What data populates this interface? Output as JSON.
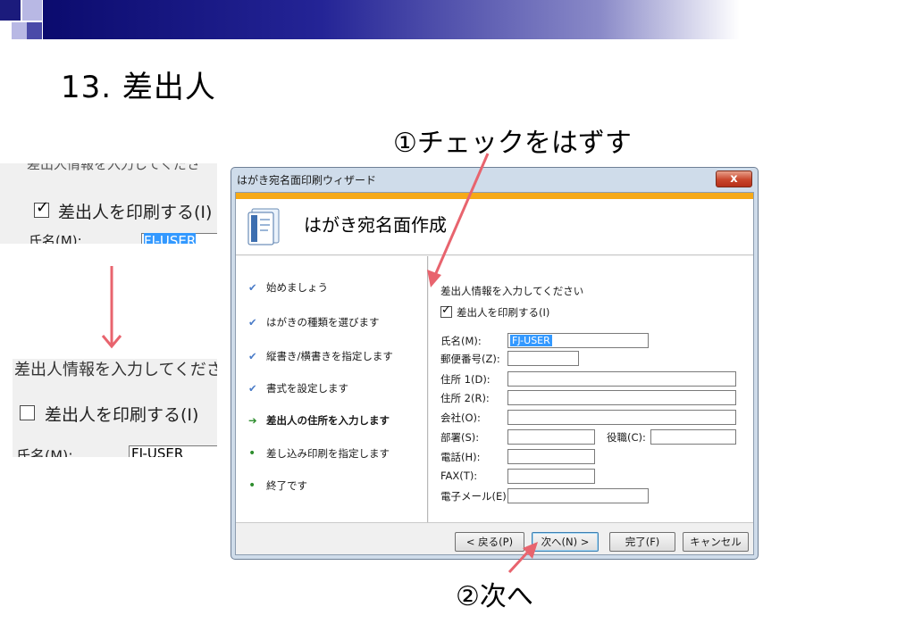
{
  "slide": {
    "title": "13. 差出人"
  },
  "annotations": {
    "step1": "①チェックをはずす",
    "step2": "②次へ"
  },
  "zoom_before": {
    "header_text": "差出人情報を入力してくださ",
    "checkbox_label": "差出人を印刷する(I)",
    "checkbox_checked": true,
    "name_label": "氏名(M):",
    "name_value": "FJ-USER"
  },
  "zoom_after": {
    "header_text": "差出人情報を入力してくださ",
    "checkbox_label": "差出人を印刷する(I)",
    "checkbox_checked": false,
    "name_label": "氏名(M):",
    "name_value": "FJ-USER"
  },
  "window": {
    "title": "はがき宛名面印刷ウィザード",
    "close_label": "x",
    "banner_title": "はがき宛名面作成",
    "steps": [
      {
        "label": "始めましょう",
        "state": "done"
      },
      {
        "label": "はがきの種類を選びます",
        "state": "done"
      },
      {
        "label": "縦書き/横書きを指定します",
        "state": "done"
      },
      {
        "label": "書式を設定します",
        "state": "done"
      },
      {
        "label": "差出人の住所を入力します",
        "state": "current"
      },
      {
        "label": "差し込み印刷を指定します",
        "state": "pending"
      },
      {
        "label": "終了です",
        "state": "pending"
      }
    ],
    "form": {
      "heading": "差出人情報を入力してください",
      "print_sender_label": "差出人を印刷する(I)",
      "print_sender_checked": true,
      "name_label": "氏名(M):",
      "name_value": "FJ-USER",
      "postal_label": "郵便番号(Z):",
      "address1_label": "住所 1(D):",
      "address2_label": "住所 2(R):",
      "company_label": "会社(O):",
      "department_label": "部署(S):",
      "position_label": "役職(C):",
      "phone_label": "電話(H):",
      "fax_label": "FAX(T):",
      "email_label": "電子メール(E)"
    },
    "buttons": {
      "back": "< 戻る(P)",
      "next": "次へ(N) >",
      "finish": "完了(F)",
      "cancel": "キャンセル"
    }
  },
  "colors": {
    "accent_orange": "#f6a917",
    "arrow_red": "#e8646e",
    "header_navy": "#0b0b6e",
    "selection_blue": "#3399ff"
  }
}
